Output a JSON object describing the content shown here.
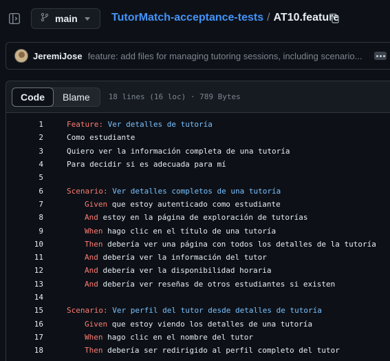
{
  "branch": {
    "name": "main"
  },
  "breadcrumb": {
    "repo": "TutorMatch-acceptance-tests",
    "separator": "/",
    "file": "AT10.feature"
  },
  "commit": {
    "author": "JeremiJose",
    "message": "feature: add files for managing tutoring sessions, including scenario..."
  },
  "file_header": {
    "tab_code": "Code",
    "tab_blame": "Blame",
    "meta": "18 lines (16 loc) · 789 Bytes"
  },
  "lines": [
    {
      "n": "1",
      "indent": false,
      "kw": "Feature:",
      "rest": " Ver detalles de tutoría",
      "heading": true
    },
    {
      "n": "2",
      "indent": false,
      "kw": "",
      "rest": "Como estudiante",
      "heading": false
    },
    {
      "n": "3",
      "indent": false,
      "kw": "",
      "rest": "Quiero ver la información completa de una tutoría",
      "heading": false
    },
    {
      "n": "4",
      "indent": false,
      "kw": "",
      "rest": "Para decidir si es adecuada para mí",
      "heading": false
    },
    {
      "n": "5",
      "indent": false,
      "kw": "",
      "rest": "",
      "heading": false
    },
    {
      "n": "6",
      "indent": false,
      "kw": "Scenario:",
      "rest": " Ver detalles completos de una tutoría",
      "heading": true
    },
    {
      "n": "7",
      "indent": true,
      "kw": "Given",
      "rest": " que estoy autenticado como estudiante",
      "heading": false
    },
    {
      "n": "8",
      "indent": true,
      "kw": "And",
      "rest": " estoy en la página de exploración de tutorías",
      "heading": false
    },
    {
      "n": "9",
      "indent": true,
      "kw": "When",
      "rest": " hago clic en el título de una tutoría",
      "heading": false
    },
    {
      "n": "10",
      "indent": true,
      "kw": "Then",
      "rest": " debería ver una página con todos los detalles de la tutoría",
      "heading": false
    },
    {
      "n": "11",
      "indent": true,
      "kw": "And",
      "rest": " debería ver la información del tutor",
      "heading": false
    },
    {
      "n": "12",
      "indent": true,
      "kw": "And",
      "rest": " debería ver la disponibilidad horaria",
      "heading": false
    },
    {
      "n": "13",
      "indent": true,
      "kw": "And",
      "rest": " debería ver reseñas de otros estudiantes si existen",
      "heading": false
    },
    {
      "n": "14",
      "indent": false,
      "kw": "",
      "rest": "",
      "heading": false
    },
    {
      "n": "15",
      "indent": false,
      "kw": "Scenario:",
      "rest": " Ver perfil del tutor desde detalles de tutoría",
      "heading": true
    },
    {
      "n": "16",
      "indent": true,
      "kw": "Given",
      "rest": " que estoy viendo los detalles de una tutoría",
      "heading": false
    },
    {
      "n": "17",
      "indent": true,
      "kw": "When",
      "rest": " hago clic en el nombre del tutor",
      "heading": false
    },
    {
      "n": "18",
      "indent": true,
      "kw": "Then",
      "rest": " debería ser redirigido al perfil completo del tutor",
      "heading": false
    }
  ],
  "colors": {
    "keyword": "#ff7b72",
    "title": "#79c0ff",
    "link": "#4493f8"
  }
}
